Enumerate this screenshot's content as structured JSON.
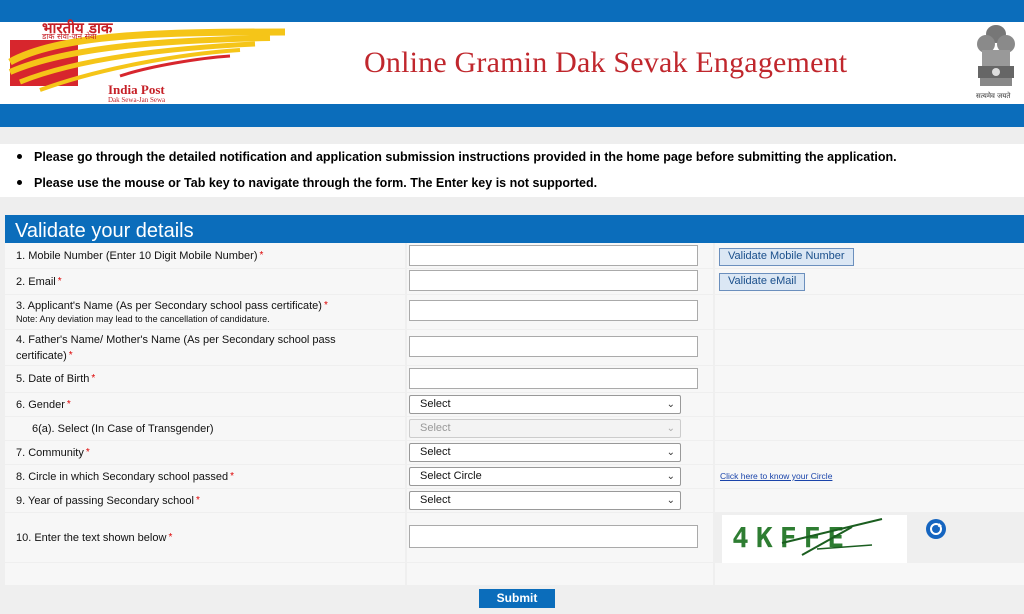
{
  "header": {
    "logo_hindi": "भारतीय डाक",
    "logo_hindi_sub": "डाक सेवा-जन सेवा",
    "logo_text": "India Post",
    "logo_tagline": "Dak Sewa-Jan Sewa",
    "title": "Online Gramin Dak Sevak Engagement",
    "emblem_motto": "सत्यमेव जयते"
  },
  "notices": [
    "Please go through the detailed notification and application submission instructions provided in the home page before submitting the application.",
    "Please use the mouse or Tab key to navigate through the form. The Enter key is not supported."
  ],
  "form": {
    "heading": "Validate your details",
    "required_mark": "*",
    "fields": {
      "mobile": {
        "label": "1. Mobile Number (Enter 10 Digit Mobile Number)",
        "value": "",
        "button": "Validate Mobile Number"
      },
      "email": {
        "label": "2. Email",
        "value": "",
        "button": "Validate eMail"
      },
      "name": {
        "label": "3. Applicant's Name (As per Secondary school pass certificate)",
        "note": "Note: Any deviation may lead to the cancellation of candidature.",
        "value": ""
      },
      "parent": {
        "label": "4. Father's Name/ Mother's Name (As per Secondary school pass certificate)",
        "value": ""
      },
      "dob": {
        "label": "5. Date of Birth",
        "value": ""
      },
      "gender": {
        "label": "6. Gender",
        "selected": "Select"
      },
      "transgender": {
        "label": "6(a). Select (In Case of Transgender)",
        "selected": "Select"
      },
      "community": {
        "label": "7. Community",
        "selected": "Select"
      },
      "circle": {
        "label": "8. Circle in which Secondary school passed",
        "selected": "Select Circle",
        "link": "Click here to know your Circle"
      },
      "year": {
        "label": "9. Year of passing Secondary school",
        "selected": "Select"
      },
      "captcha": {
        "label": "10. Enter the text shown below",
        "value": "",
        "image_text": "4KFFE"
      }
    },
    "submit_label": "Submit"
  },
  "colors": {
    "primary_blue": "#0b6dbb",
    "title_red": "#c0272d",
    "required_red": "#dd0000"
  }
}
